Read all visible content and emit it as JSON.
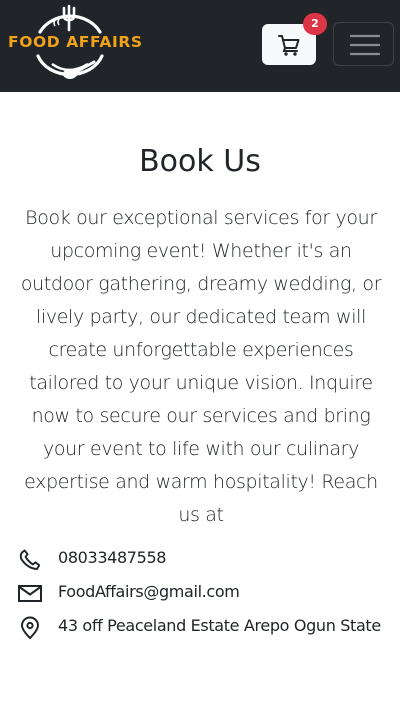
{
  "brand": {
    "name": "FOOD AFFAIRS",
    "logo_icon": "fork-spoon-plate-logo",
    "accent": "#f0a21a"
  },
  "navbar": {
    "background": "#212529",
    "cart_icon": "cart-icon",
    "cart_count": "2",
    "menu_icon": "hamburger-icon"
  },
  "main": {
    "title": "Book Us",
    "description": "Book our exceptional services for your upcoming event! Whether it's an outdoor gathering, dreamy wedding, or lively party, our dedicated team will create unforgettable experiences tailored to your unique vision. Inquire now to secure our services and bring your event to life with our culinary expertise and warm hospitality! Reach us at"
  },
  "contact": {
    "phone": {
      "icon": "phone-icon",
      "value": "08033487558"
    },
    "email": {
      "icon": "envelope-icon",
      "value": "FoodAffairs@gmail.com"
    },
    "address": {
      "icon": "location-pin-icon",
      "value": "43 off Peaceland Estate Arepo Ogun State"
    }
  }
}
